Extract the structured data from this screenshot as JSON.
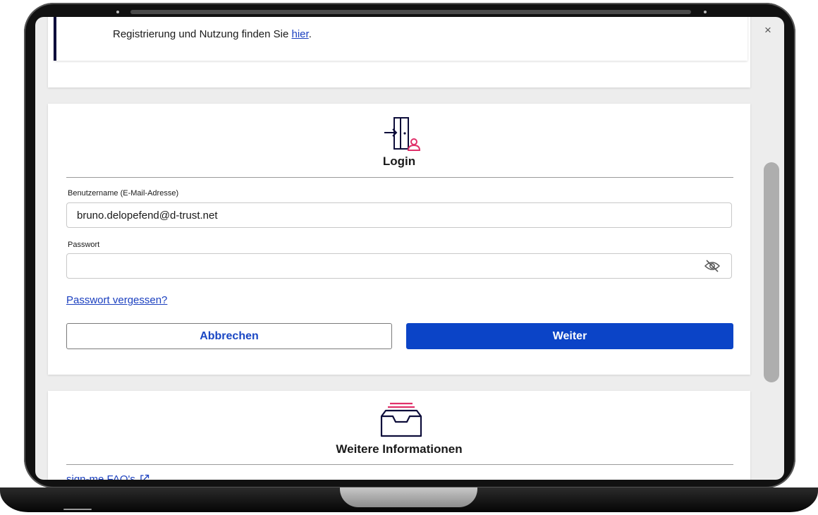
{
  "notice": {
    "text_prefix": "Registrierung und Nutzung finden Sie ",
    "link_label": "hier",
    "text_suffix": "."
  },
  "login": {
    "icon": "login-door-icon",
    "title": "Login",
    "username_label": "Benutzername (E-Mail-Adresse)",
    "username_value": "bruno.delopefend@d-trust.net",
    "password_label": "Passwort",
    "password_value": "",
    "password_toggle_icon": "eye-slash-icon",
    "forgot_password_label": "Passwort vergessen?",
    "cancel_label": "Abbrechen",
    "next_label": "Weiter"
  },
  "info": {
    "icon": "inbox-tray-icon",
    "title": "Weitere Informationen",
    "faq_label": "sign-me FAQ's",
    "faq_icon": "external-link-icon"
  },
  "window": {
    "close_glyph": "×"
  },
  "colors": {
    "primary": "#0b44c7",
    "link": "#1a3fbf",
    "accent_pink": "#e0316a",
    "navy": "#0d0d3a",
    "page_background": "#ededed"
  }
}
